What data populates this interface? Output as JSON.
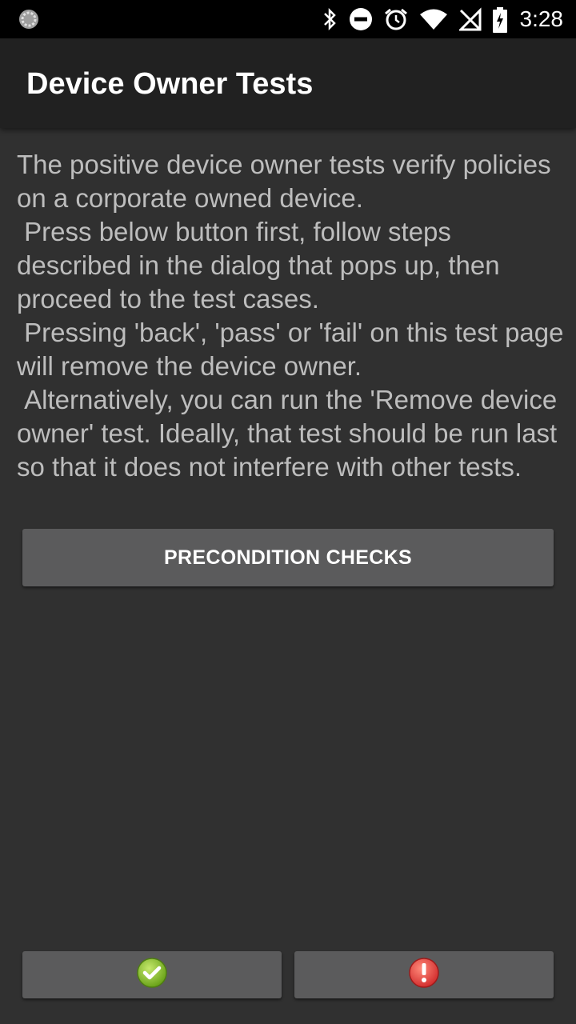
{
  "status_bar": {
    "time": "3:28",
    "left_icon": "sync-progress-icon",
    "icons": [
      "bluetooth-icon",
      "do-not-disturb-icon",
      "alarm-icon",
      "wifi-icon",
      "no-sim-icon",
      "battery-charging-icon"
    ]
  },
  "app_bar": {
    "title": "Device Owner Tests"
  },
  "content": {
    "description": "The positive device owner tests verify policies on a corporate owned device.\n Press below button first, follow steps described in the dialog that pops up, then proceed to the test cases.\n Pressing 'back', 'pass' or 'fail' on this test page will remove the device owner.\n Alternatively, you can run the 'Remove device owner' test. Ideally, that test should be run last so that it does not interfere with other tests.",
    "precondition_button_label": "PRECONDITION CHECKS"
  },
  "footer": {
    "pass_icon": "checkmark-icon",
    "fail_icon": "exclamation-icon"
  },
  "colors": {
    "status_bar": "#000000",
    "app_bar": "#212121",
    "background": "#303030",
    "button": "#5b5b5c",
    "pass_green": "#8bc34a",
    "fail_red": "#e53935"
  }
}
